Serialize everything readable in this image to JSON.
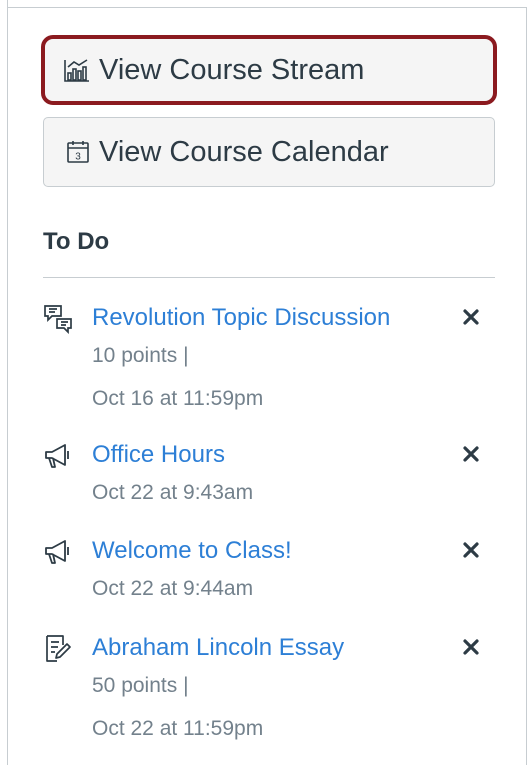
{
  "actions": {
    "stream_label": "View Course Stream",
    "calendar_label": "View Course Calendar"
  },
  "todo": {
    "heading": "To Do",
    "items": [
      {
        "icon": "discussion-icon",
        "title": "Revolution Topic Discussion",
        "points": "10 points |",
        "due": "Oct 16 at 11:59pm"
      },
      {
        "icon": "announcement-icon",
        "title": "Office Hours",
        "due": "Oct 22 at 9:43am"
      },
      {
        "icon": "announcement-icon",
        "title": "Welcome to Class!",
        "due": "Oct 22 at 9:44am"
      },
      {
        "icon": "assignment-icon",
        "title": "Abraham Lincoln Essay",
        "points": "50 points |",
        "due": "Oct 22 at 11:59pm"
      }
    ]
  },
  "colors": {
    "link": "#2d7fd6",
    "text": "#2d3b45",
    "muted": "#73818c",
    "highlight": "#8b1a1f"
  }
}
